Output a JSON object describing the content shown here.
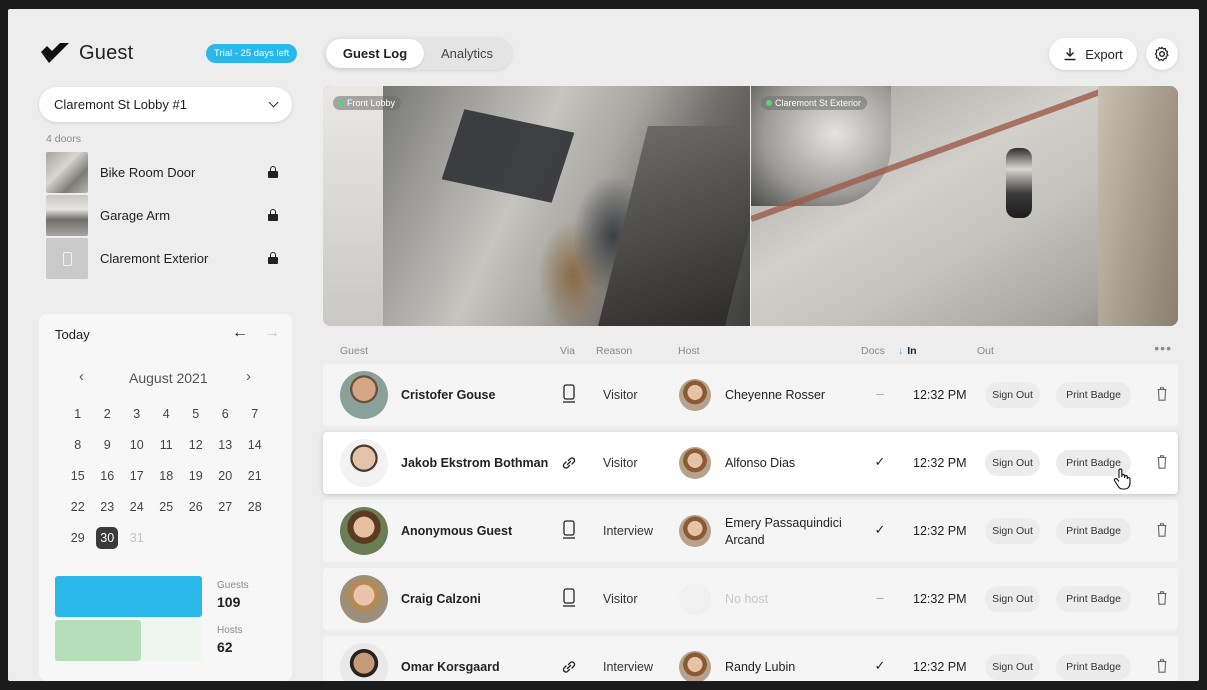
{
  "app": {
    "name": "Guest",
    "trial": "Trial - 25 days left"
  },
  "location": {
    "selected": "Claremont St Lobby #1"
  },
  "doors": {
    "count_label": "4 doors",
    "items": [
      {
        "name": "Bike Room Door"
      },
      {
        "name": "Garage Arm"
      },
      {
        "name": "Claremont Exterior"
      }
    ]
  },
  "calendar": {
    "today_label": "Today",
    "month": "August 2021",
    "weeks": [
      [
        "1",
        "2",
        "3",
        "4",
        "5",
        "6",
        "7"
      ],
      [
        "8",
        "9",
        "10",
        "11",
        "12",
        "13",
        "14"
      ],
      [
        "15",
        "16",
        "17",
        "18",
        "19",
        "20",
        "21"
      ],
      [
        "22",
        "23",
        "24",
        "25",
        "26",
        "27",
        "28"
      ],
      [
        "29",
        "30",
        "31"
      ]
    ],
    "selected_day": "30"
  },
  "stats": {
    "guests_label": "Guests",
    "guests_value": "109",
    "hosts_label": "Hosts",
    "hosts_value": "62"
  },
  "tabs": [
    {
      "label": "Guest Log"
    },
    {
      "label": "Analytics"
    }
  ],
  "toolbar": {
    "export_label": "Export"
  },
  "cameras": [
    {
      "label": "Front Lobby"
    },
    {
      "label": "Claremont St Exterior"
    }
  ],
  "table": {
    "headers": {
      "guest": "Guest",
      "via": "Via",
      "reason": "Reason",
      "host": "Host",
      "docs": "Docs",
      "in": "In",
      "out": "Out"
    },
    "rows": [
      {
        "guest": "Cristofer Gouse",
        "via": "tablet",
        "reason": "Visitor",
        "host": "Cheyenne Rosser",
        "docs": "–",
        "time_in": "12:32 PM",
        "sign_out": "Sign Out",
        "print_badge": "Print Badge"
      },
      {
        "guest": "Jakob Ekstrom Bothman",
        "via": "link",
        "reason": "Visitor",
        "host": "Alfonso Dias",
        "docs": "✓",
        "time_in": "12:32 PM",
        "sign_out": "Sign Out",
        "print_badge": "Print Badge"
      },
      {
        "guest": "Anonymous Guest",
        "via": "tablet",
        "reason": "Interview",
        "host_line1": "Emery Passaquindici",
        "host_line2": "Arcand",
        "docs": "✓",
        "time_in": "12:32 PM",
        "sign_out": "Sign Out",
        "print_badge": "Print Badge"
      },
      {
        "guest": "Craig Calzoni",
        "via": "tablet",
        "reason": "Visitor",
        "host": "No host",
        "docs": "–",
        "time_in": "12:32 PM",
        "sign_out": "Sign Out",
        "print_badge": "Print Badge"
      },
      {
        "guest": "Omar Korsgaard",
        "via": "link",
        "reason": "Interview",
        "host": "Randy Lubin",
        "docs": "✓",
        "time_in": "12:32 PM",
        "sign_out": "Sign Out",
        "print_badge": "Print Badge"
      }
    ]
  },
  "colors": {
    "accent": "#2ab7ea",
    "hosts_bar": "#b4dfb8",
    "selected_day": "#3a3a3a"
  },
  "icons": [
    "logo-check-icon",
    "chevron-down-icon",
    "lock-icon",
    "arrow-left-icon",
    "arrow-right-icon",
    "download-icon",
    "gear-icon",
    "tablet-icon",
    "link-icon",
    "check-icon",
    "trash-icon",
    "more-icon",
    "hand-cursor-icon"
  ]
}
